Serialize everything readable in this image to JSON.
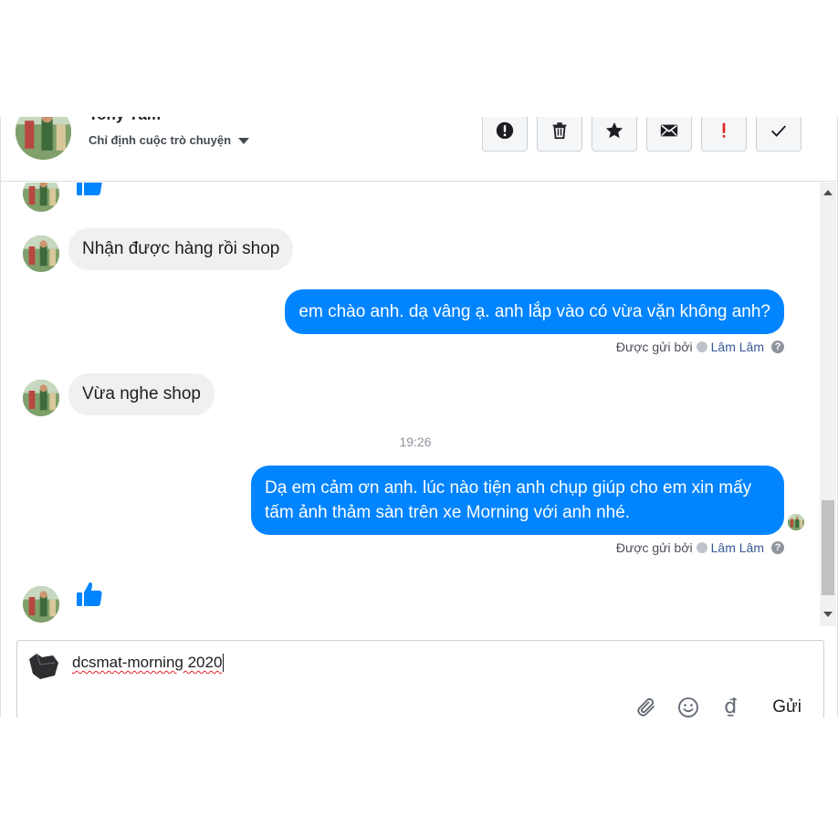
{
  "header": {
    "contact_name": "Tony Tâm",
    "assign_label": "Chỉ định cuộc trò chuyện"
  },
  "actions": [
    {
      "icon": "alert-circle-icon"
    },
    {
      "icon": "trash-icon"
    },
    {
      "icon": "star-icon"
    },
    {
      "icon": "envelope-icon"
    },
    {
      "icon": "exclamation-icon",
      "color": "#e0262a"
    },
    {
      "icon": "check-icon"
    }
  ],
  "thread": {
    "messages": [
      {
        "direction": "in",
        "type": "like"
      },
      {
        "direction": "in",
        "text": "Nhận được hàng rồi shop"
      },
      {
        "direction": "out",
        "text": "em chào anh. dạ vâng ạ. anh lắp vào có vừa vặn không anh?",
        "meta_label": "Được gửi bởi",
        "agent": "Lâm Lâm"
      },
      {
        "direction": "in",
        "text": "Vừa nghe shop"
      },
      {
        "type": "time",
        "text": "19:26"
      },
      {
        "direction": "out",
        "text": "Dạ em cảm ơn anh. lúc nào tiện anh chụp giúp cho em xin mấy tấm ảnh thảm sàn trên xe Morning với anh nhé.",
        "meta_label": "Được gửi bởi",
        "agent": "Lâm Lâm"
      },
      {
        "direction": "in",
        "type": "like"
      }
    ]
  },
  "composer": {
    "value": "dcsmat-morning 2020",
    "currency_symbol": "₫",
    "send_label": "Gửi"
  },
  "colors": {
    "outgoing_bubble": "#0084ff",
    "incoming_bubble": "#f0f0f0",
    "like_blue": "#0084ff"
  }
}
